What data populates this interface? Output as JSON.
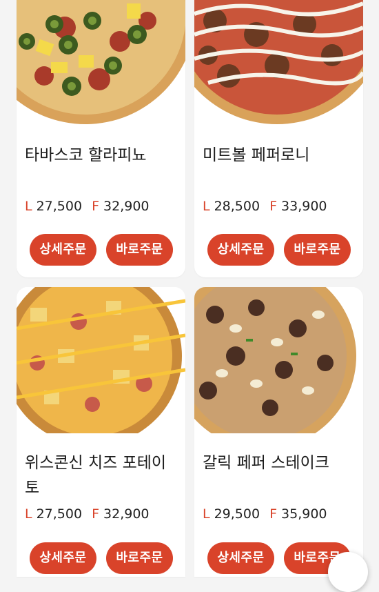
{
  "colors": {
    "accent": "#d9432a",
    "background": "#f4f4f4",
    "card": "#ffffff"
  },
  "menu": {
    "items": [
      {
        "name": "타바스코 할라피뇨",
        "price_l_label": "L",
        "price_l": "27,500",
        "price_f_label": "F",
        "price_f": "32,900",
        "detail_label": "상세주문",
        "quick_label": "바로주문"
      },
      {
        "name": "미트볼 페퍼로니",
        "price_l_label": "L",
        "price_l": "28,500",
        "price_f_label": "F",
        "price_f": "33,900",
        "detail_label": "상세주문",
        "quick_label": "바로주문"
      },
      {
        "name": "위스콘신 치즈 포테이토",
        "price_l_label": "L",
        "price_l": "27,500",
        "price_f_label": "F",
        "price_f": "32,900",
        "detail_label": "상세주문",
        "quick_label": "바로주문"
      },
      {
        "name": "갈릭 페퍼 스테이크",
        "price_l_label": "L",
        "price_l": "29,500",
        "price_f_label": "F",
        "price_f": "35,900",
        "detail_label": "상세주문",
        "quick_label": "바로주문"
      }
    ]
  }
}
